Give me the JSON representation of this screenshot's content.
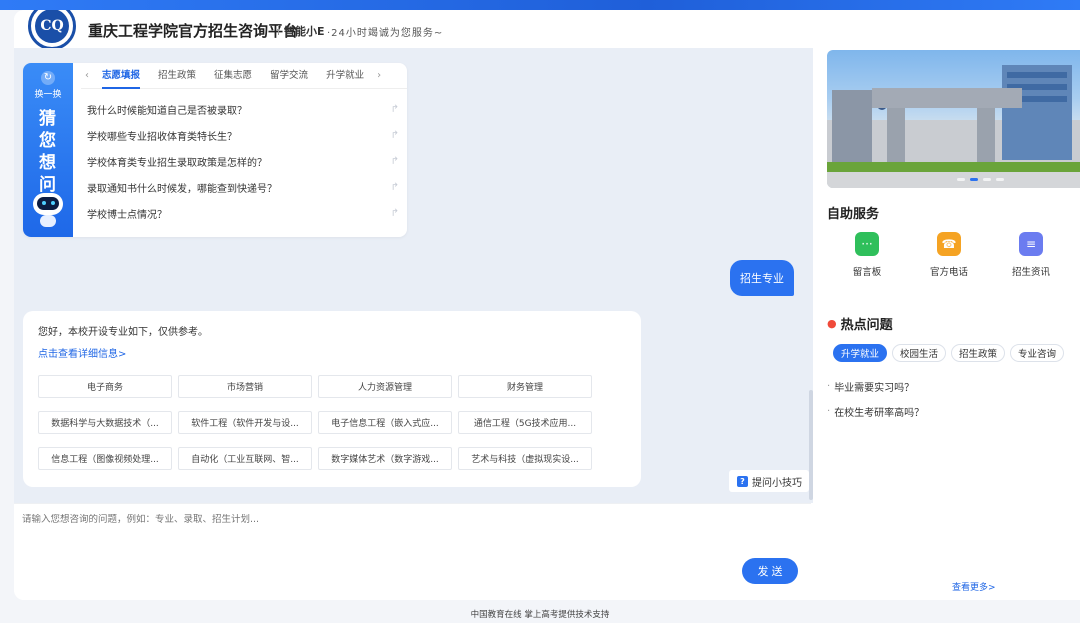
{
  "header": {
    "logo_text": "CQ",
    "title": "重庆工程学院官方招生咨询平台",
    "bot_name": "智能小E",
    "slogan": "·24小时竭诚为您服务~"
  },
  "guess": {
    "refresh_label": "换一换",
    "big_title": [
      "猜",
      "您",
      "想",
      "问"
    ],
    "tabs": [
      {
        "label": "志愿填报",
        "active": true
      },
      {
        "label": "招生政策",
        "active": false
      },
      {
        "label": "征集志愿",
        "active": false
      },
      {
        "label": "留学交流",
        "active": false
      },
      {
        "label": "升学就业",
        "active": false
      }
    ],
    "questions": [
      "我什么时候能知道自己是否被录取？",
      "学校哪些专业招收体育类特长生？",
      "学校体育类专业招生录取政策是怎样的？",
      "录取通知书什么时候发，哪能查到快递号？",
      "学校博士点情况？"
    ]
  },
  "chat": {
    "user_message": "招生专业",
    "answer_intro": "您好，本校开设专业如下，仅供参考。",
    "answer_link": "点击查看详细信息>",
    "majors": [
      "电子商务",
      "市场营销",
      "人力资源管理",
      "财务管理",
      "数据科学与大数据技术（...",
      "软件工程（软件开发与设...",
      "电子信息工程（嵌入式应...",
      "通信工程（5G技术应用...",
      "信息工程（图像视频处理...",
      "自动化（工业互联网、智...",
      "数字媒体艺术（数字游戏...",
      "艺术与科技（虚拟现实设..."
    ],
    "tips_label": "提问小技巧"
  },
  "input": {
    "placeholder": "请输入您想咨询的问题，例如：专业、录取、招生计划...",
    "send_label": "发 送"
  },
  "right": {
    "self_service_title": "自助服务",
    "services": [
      {
        "label": "留言板",
        "icon": "message-board-icon",
        "color": "#2fbf5b",
        "glyph": "···"
      },
      {
        "label": "官方电话",
        "icon": "phone-icon",
        "color": "#f5a323",
        "glyph": "☎"
      },
      {
        "label": "招生资讯",
        "icon": "news-icon",
        "color": "#6b7cf0",
        "glyph": "≡"
      }
    ],
    "hot_title": "热点问题",
    "hot_tabs": [
      {
        "label": "升学就业",
        "active": true
      },
      {
        "label": "校园生活",
        "active": false
      },
      {
        "label": "招生政策",
        "active": false
      },
      {
        "label": "专业咨询",
        "active": false
      }
    ],
    "hot_questions": [
      "毕业需要实习吗？",
      "在校生考研率高吗？"
    ],
    "see_more": "查看更多>"
  },
  "footer": {
    "text": "中国教育在线 掌上高考提供技术支持"
  },
  "colors": {
    "primary": "#2b72f0",
    "top_band": "#2f7bf6",
    "chat_bg": "#e9eef6"
  }
}
